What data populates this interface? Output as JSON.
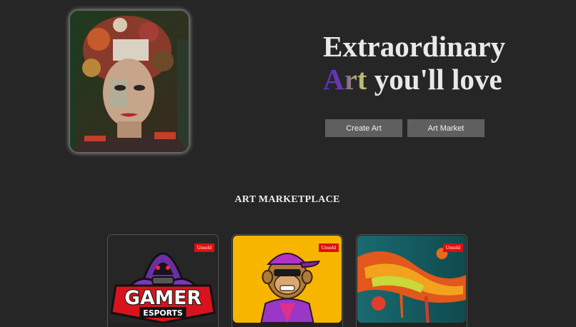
{
  "hero": {
    "title_line1": "Extraordinary",
    "title_art_word": "Art",
    "title_line2_rest": " you'll love",
    "create_button": "Create Art",
    "market_button": "Art Market",
    "portrait_icon": "portrait-artwork"
  },
  "marketplace": {
    "title": "ART MARKETPLACE",
    "cards": [
      {
        "badge": "Unsold",
        "logo_top": "GAMER",
        "logo_bottom": "ESPORTS",
        "image": "gamer-esports-logo"
      },
      {
        "badge": "Unsold",
        "image": "cartoon-ape-with-cap"
      },
      {
        "badge": "Unsold",
        "image": "abstract-paint-splash"
      }
    ]
  },
  "colors": {
    "background": "#262626",
    "button": "#5f5f5f",
    "badge": "#e00d0d",
    "ape_background": "#f7b500"
  }
}
